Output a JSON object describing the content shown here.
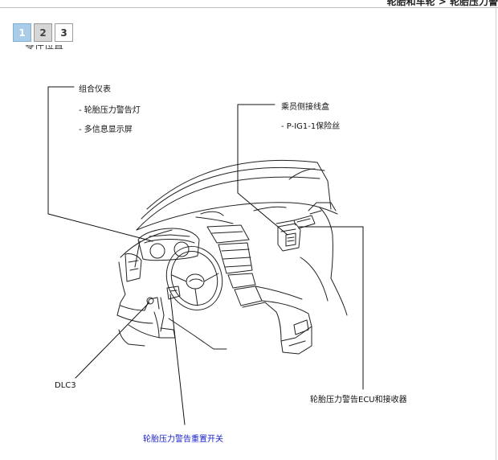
{
  "breadcrumb": "轮胎和车轮 > 轮胎压力警",
  "pager": {
    "pages": [
      "1",
      "2",
      "3"
    ],
    "active": "1"
  },
  "cut_heading": "零件位置",
  "labels": {
    "combo_meter": "组合仪表",
    "combo_item1": "- 轮胎压力警告灯",
    "combo_item2": "- 多信息显示屏",
    "junction": "乘员侧接线盒",
    "junction_item": "- P-IG1-1保险丝",
    "dlc3": "DLC3",
    "ecu": "轮胎压力警告ECU和接收器",
    "reset_switch": "轮胎压力警告重置开关"
  }
}
